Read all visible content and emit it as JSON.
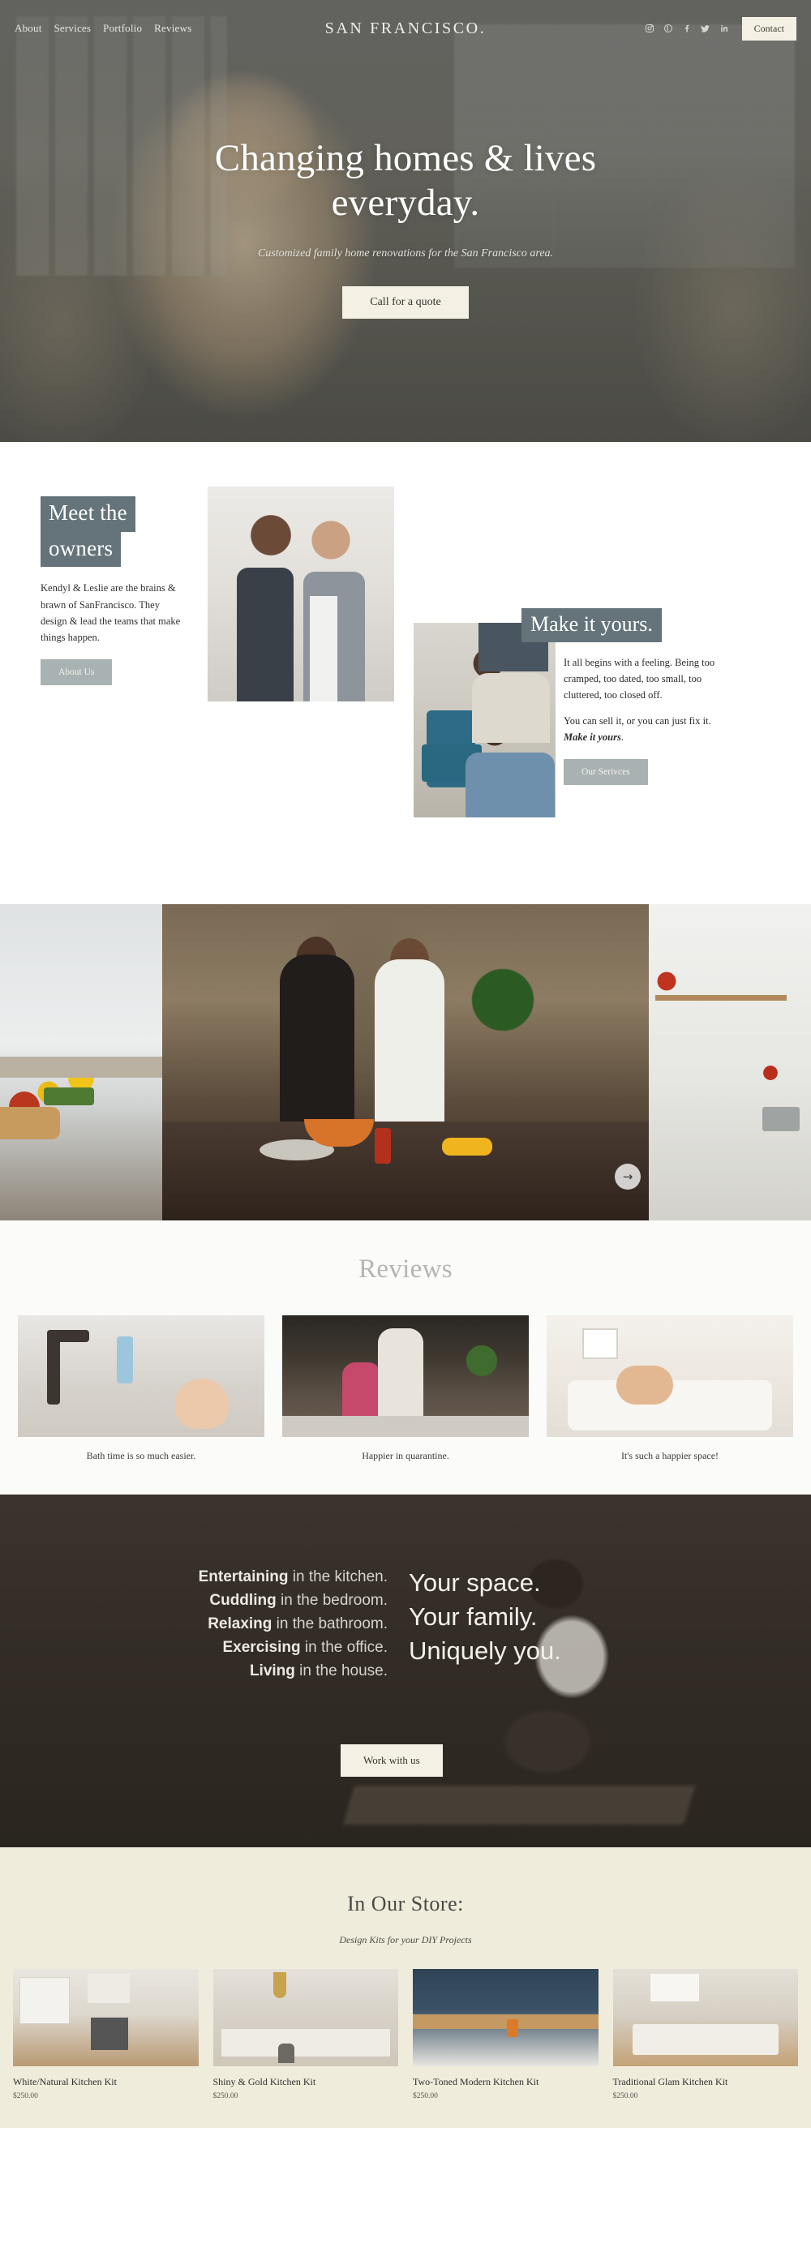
{
  "nav": {
    "links": [
      "About",
      "Services",
      "Portfolio",
      "Reviews"
    ],
    "brand": "SAN FRANCISCO.",
    "social": [
      "instagram-icon",
      "pinterest-icon",
      "facebook-icon",
      "twitter-icon",
      "linkedin-icon"
    ],
    "contact_label": "Contact"
  },
  "hero": {
    "title": "Changing homes & lives everyday.",
    "subtitle": "Customized family home renovations for the San Francisco area.",
    "cta_label": "Call for a quote"
  },
  "owners": {
    "heading_line1": "Meet the",
    "heading_line2": "owners",
    "body": "Kendyl & Leslie are the brains & brawn of SanFrancisco. They design & lead the teams that make things happen.",
    "button_label": "About Us"
  },
  "yours": {
    "heading": "Make it yours.",
    "paragraph1": "It all begins with a feeling. Being too cramped, too dated, too small, too cluttered, too closed off.",
    "paragraph2_prefix": "You can sell it, or you can just fix it. ",
    "paragraph2_bold": "Make it yours",
    "paragraph2_suffix": ".",
    "button_label": "Our Serivces"
  },
  "gallery": {
    "next_icon": "arrow-right-icon",
    "next_glyph": "→"
  },
  "reviews": {
    "title": "Reviews",
    "prev_glyph": "‹",
    "next_glyph": "›",
    "items": [
      {
        "caption": "Bath time is so much easier."
      },
      {
        "caption": "Happier in quarantine."
      },
      {
        "caption": "It's such a happier space!"
      }
    ]
  },
  "dark": {
    "lines": [
      {
        "bold": "Entertaining",
        "rest": " in the kitchen."
      },
      {
        "bold": "Cuddling",
        "rest": " in the bedroom."
      },
      {
        "bold": "Relaxing",
        "rest": " in the bathroom."
      },
      {
        "bold": "Exercising",
        "rest": " in the office."
      },
      {
        "bold": "Living",
        "rest": " in the house."
      }
    ],
    "big_line1": "Your space.",
    "big_line2": "Your family.",
    "big_line3": "Uniquely you.",
    "cta_label": "Work with us"
  },
  "store": {
    "title": "In Our Store:",
    "subtitle": "Design Kits for your DIY Projects",
    "prev_glyph": "‹",
    "next_glyph": "›",
    "products": [
      {
        "name": "White/Natural Kitchen Kit",
        "price": "$250.00"
      },
      {
        "name": "Shiny & Gold Kitchen Kit",
        "price": "$250.00"
      },
      {
        "name": "Two-Toned Modern Kitchen Kit",
        "price": "$250.00"
      },
      {
        "name": "Traditional Glam Kitchen Kit",
        "price": "$250.00"
      }
    ]
  },
  "colors": {
    "accent_slate": "#64747a",
    "button_cream": "#f4f1e4",
    "button_gray": "#a9b2b2",
    "store_bg": "#f0ecdc",
    "dark_bg": "#332d26"
  }
}
